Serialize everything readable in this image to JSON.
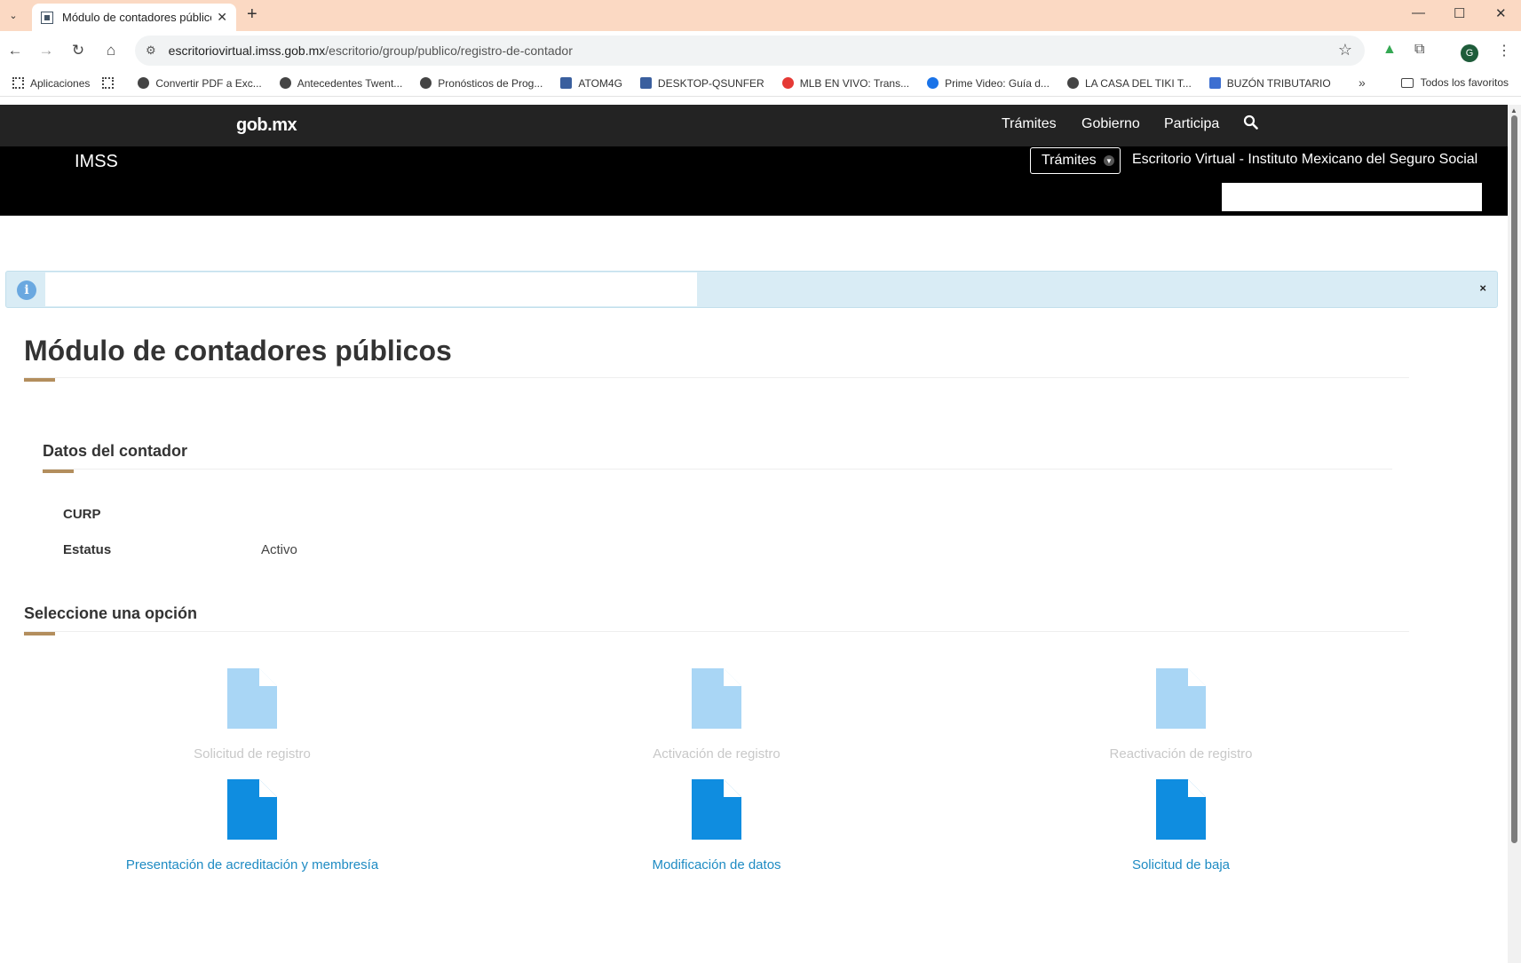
{
  "browser": {
    "tab_title": "Módulo de contadores públicos",
    "close_glyph": "✕",
    "new_tab_glyph": "+",
    "url_host": "escritoriovirtual.imss.gob.mx",
    "url_path": "/escritorio/group/publico/registro-de-contador",
    "avatar_letter": "G",
    "bookmarks": [
      {
        "label": "Aplicaciones",
        "icon": "apps-grid-icon"
      },
      {
        "label": "",
        "icon": "grid-icon"
      },
      {
        "label": "Convertir PDF a Exc...",
        "icon": "globe-icon"
      },
      {
        "label": "Antecedentes Twent...",
        "icon": "feather-icon"
      },
      {
        "label": "Pronósticos de Prog...",
        "icon": "soccer-icon"
      },
      {
        "label": "ATOM4G",
        "icon": "page-icon"
      },
      {
        "label": "DESKTOP-QSUNFER",
        "icon": "page-icon"
      },
      {
        "label": "MLB EN VIVO: Trans...",
        "icon": "play-red-icon"
      },
      {
        "label": "Prime Video: Guía d...",
        "icon": "play-blue-icon"
      },
      {
        "label": "LA CASA DEL TIKI T...",
        "icon": "globe-icon"
      },
      {
        "label": "BUZÓN TRIBUTARIO",
        "icon": "blocks-icon"
      }
    ],
    "bookmarks_more": "»",
    "all_bookmarks": "Todos los favoritos"
  },
  "gob": {
    "logo": "gob.mx",
    "nav": [
      "Trámites",
      "Gobierno",
      "Participa"
    ]
  },
  "imss": {
    "logo": "IMSS",
    "tramites_button": "Trámites",
    "escritorio_title": "Escritorio Virtual - Instituto Mexicano del Seguro Social",
    "search_value": ""
  },
  "alert": {
    "close": "×",
    "info_glyph": "i"
  },
  "page": {
    "title": "Módulo de contadores públicos",
    "datos_title": "Datos del contador",
    "fields": [
      {
        "label": "CURP",
        "value": ""
      },
      {
        "label": "Estatus",
        "value": "Activo"
      }
    ],
    "seleccione_title": "Seleccione una opción",
    "options": [
      {
        "label": "Solicitud de registro",
        "enabled": false
      },
      {
        "label": "Activación de registro",
        "enabled": false
      },
      {
        "label": "Reactivación de registro",
        "enabled": false
      },
      {
        "label": "Presentación de acreditación y membresía",
        "enabled": true
      },
      {
        "label": "Modificación de datos",
        "enabled": true
      },
      {
        "label": "Solicitud de baja",
        "enabled": true
      }
    ]
  },
  "colors": {
    "gold_accent": "#b38e5d",
    "doc_disabled": "#a9d6f5",
    "doc_enabled": "#0f8de0",
    "link_blue": "#1e8bc3"
  }
}
